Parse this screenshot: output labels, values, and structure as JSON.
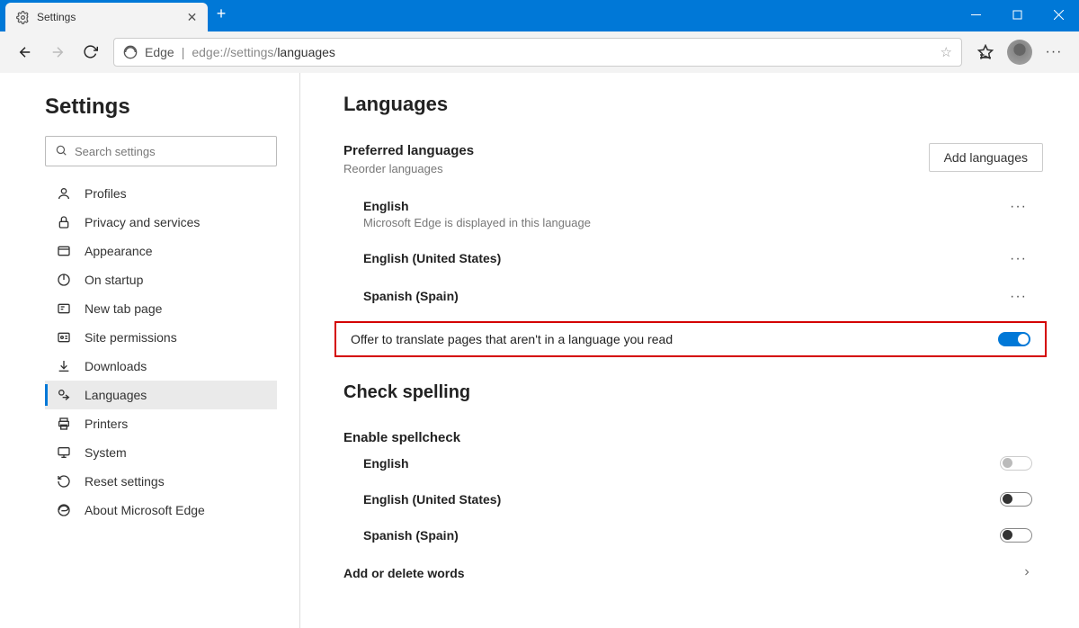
{
  "window": {
    "tab_title": "Settings"
  },
  "addressbar": {
    "product": "Edge",
    "scheme": "edge://",
    "rest": "settings/",
    "page": "languages"
  },
  "sidebar": {
    "title": "Settings",
    "search_placeholder": "Search settings",
    "items": [
      {
        "label": "Profiles"
      },
      {
        "label": "Privacy and services"
      },
      {
        "label": "Appearance"
      },
      {
        "label": "On startup"
      },
      {
        "label": "New tab page"
      },
      {
        "label": "Site permissions"
      },
      {
        "label": "Downloads"
      },
      {
        "label": "Languages"
      },
      {
        "label": "Printers"
      },
      {
        "label": "System"
      },
      {
        "label": "Reset settings"
      },
      {
        "label": "About Microsoft Edge"
      }
    ]
  },
  "main": {
    "heading": "Languages",
    "preferred": {
      "title": "Preferred languages",
      "subtitle": "Reorder languages",
      "add_button": "Add languages",
      "languages": [
        {
          "name": "English",
          "desc": "Microsoft Edge is displayed in this language"
        },
        {
          "name": "English (United States)"
        },
        {
          "name": "Spanish (Spain)"
        }
      ]
    },
    "translate_label": "Offer to translate pages that aren't in a language you read",
    "spell": {
      "heading": "Check spelling",
      "enable": "Enable spellcheck",
      "items": [
        {
          "name": "English",
          "state": "off-disabled"
        },
        {
          "name": "English (United States)",
          "state": "off"
        },
        {
          "name": "Spanish (Spain)",
          "state": "off"
        }
      ],
      "add_words": "Add or delete words"
    }
  }
}
